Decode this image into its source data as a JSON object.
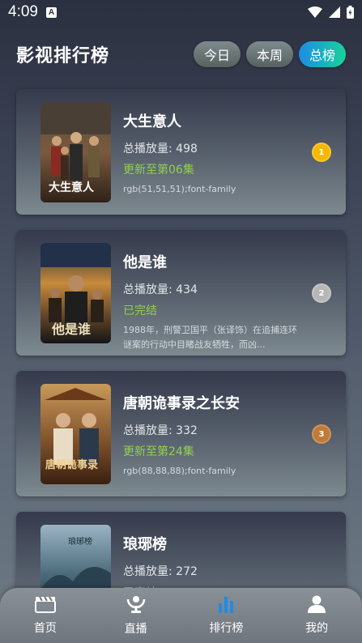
{
  "status_bar": {
    "time": "4:09",
    "notif_letter": "A"
  },
  "header": {
    "title": "影视排行榜",
    "tabs": [
      {
        "label": "今日",
        "active": false
      },
      {
        "label": "本周",
        "active": false
      },
      {
        "label": "总榜",
        "active": true
      }
    ]
  },
  "list": [
    {
      "title": "大生意人",
      "plays": "总播放量: 498",
      "status": "更新至第06集",
      "desc": "rgb(51,51,51);font-family",
      "rank": "1",
      "rank_color": "#f5b800",
      "poster_text": "大生意人"
    },
    {
      "title": "他是谁",
      "plays": "总播放量: 434",
      "status": "已完结",
      "desc": "1988年，刑警卫国平（张译饰）在追捕连环谜案的行动中目睹战友牺牲，而凶...",
      "rank": "2",
      "rank_color": "#b7b7b7",
      "poster_text": "他是谁"
    },
    {
      "title": "唐朝诡事录之长安",
      "plays": "总播放量: 332",
      "status": "更新至第24集",
      "desc": "rgb(88,88,88);font-family",
      "rank": "3",
      "rank_color": "#c07a3a",
      "poster_text": "唐朝诡事录"
    },
    {
      "title": "琅琊榜",
      "plays": "总播放量: 272",
      "status": "已完结",
      "desc": "",
      "rank": "",
      "rank_color": "",
      "poster_text": "琅琊榜"
    }
  ],
  "bottom_nav": [
    {
      "label": "首页",
      "icon": "clapperboard-icon",
      "active": false
    },
    {
      "label": "直播",
      "icon": "live-icon",
      "active": false
    },
    {
      "label": "排行榜",
      "icon": "bar-chart-icon",
      "active": true
    },
    {
      "label": "我的",
      "icon": "user-icon",
      "active": false
    }
  ],
  "colors": {
    "accent_blue": "#1e8be8",
    "accent_green": "#17d39a",
    "status_green": "#8fd14f"
  }
}
